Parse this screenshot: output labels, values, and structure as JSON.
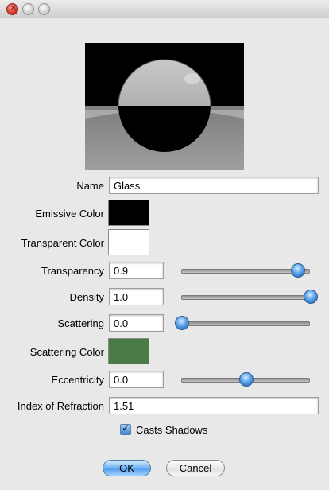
{
  "window": {
    "title": ""
  },
  "fields": {
    "name": {
      "label": "Name",
      "value": "Glass"
    },
    "emissive_color": {
      "label": "Emissive Color",
      "color": "#000000"
    },
    "transparent_color": {
      "label": "Transparent Color",
      "color": "#ffffff"
    },
    "transparency": {
      "label": "Transparency",
      "value": "0.9",
      "level": 0.9
    },
    "density": {
      "label": "Density",
      "value": "1.0",
      "level": 1.0
    },
    "scattering": {
      "label": "Scattering",
      "value": "0.0",
      "level": 0.0
    },
    "scattering_color": {
      "label": "Scattering Color",
      "color": "#4a7a45"
    },
    "eccentricity": {
      "label": "Eccentricity",
      "value": "0.0",
      "level": 0.5
    },
    "index_of_refraction": {
      "label": "Index of Refraction",
      "value": "1.51"
    }
  },
  "casts_shadows": {
    "label": "Casts Shadows",
    "checked": true
  },
  "buttons": {
    "ok": "OK",
    "cancel": "Cancel"
  },
  "accent_color": "#4d98ea"
}
